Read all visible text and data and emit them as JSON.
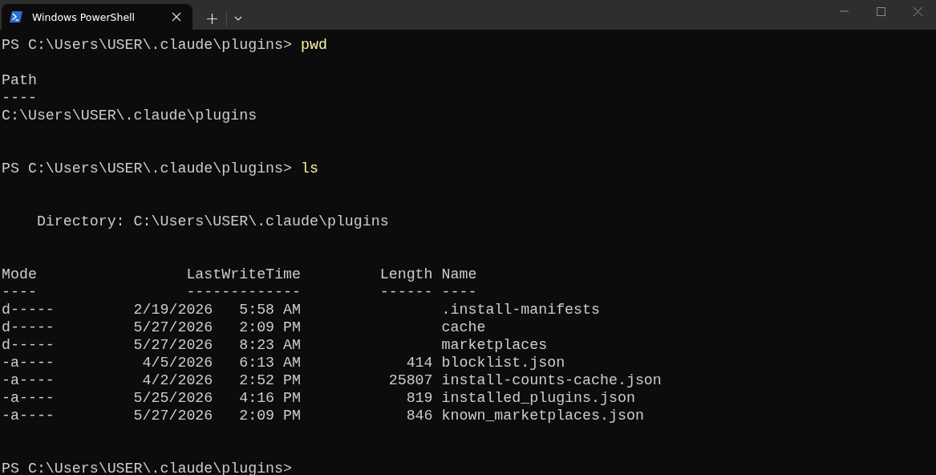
{
  "tabs": [
    {
      "title": "Windows PowerShell",
      "selected": true
    }
  ],
  "terminal": {
    "lines": [
      {
        "kind": "prompt",
        "prompt": "PS C:\\Users\\USER\\.claude\\plugins>",
        "command": "pwd"
      },
      {
        "kind": "blank"
      },
      {
        "kind": "output",
        "text": "Path"
      },
      {
        "kind": "output",
        "text": "----"
      },
      {
        "kind": "output",
        "text": "C:\\Users\\USER\\.claude\\plugins"
      },
      {
        "kind": "blank"
      },
      {
        "kind": "blank"
      },
      {
        "kind": "prompt",
        "prompt": "PS C:\\Users\\USER\\.claude\\plugins>",
        "command": "ls"
      },
      {
        "kind": "blank"
      },
      {
        "kind": "blank"
      },
      {
        "kind": "output",
        "text": "    Directory: C:\\Users\\USER\\.claude\\plugins"
      },
      {
        "kind": "blank"
      },
      {
        "kind": "blank"
      },
      {
        "kind": "output",
        "text": "Mode                 LastWriteTime         Length Name"
      },
      {
        "kind": "output",
        "text": "----                 -------------         ------ ----"
      },
      {
        "kind": "output",
        "text": "d-----         2/19/2026   5:58 AM                .install-manifests"
      },
      {
        "kind": "output",
        "text": "d-----         5/27/2026   2:09 PM                cache"
      },
      {
        "kind": "output",
        "text": "d-----         5/27/2026   8:23 AM                marketplaces"
      },
      {
        "kind": "output",
        "text": "-a----          4/5/2026   6:13 AM            414 blocklist.json"
      },
      {
        "kind": "output",
        "text": "-a----          4/2/2026   2:52 PM          25807 install-counts-cache.json"
      },
      {
        "kind": "output",
        "text": "-a----         5/25/2026   4:16 PM            819 installed_plugins.json"
      },
      {
        "kind": "output",
        "text": "-a----         5/27/2026   2:09 PM            846 known_marketplaces.json"
      },
      {
        "kind": "blank"
      },
      {
        "kind": "blank"
      },
      {
        "kind": "prompt",
        "prompt": "PS C:\\Users\\USER\\.claude\\plugins>"
      }
    ]
  }
}
